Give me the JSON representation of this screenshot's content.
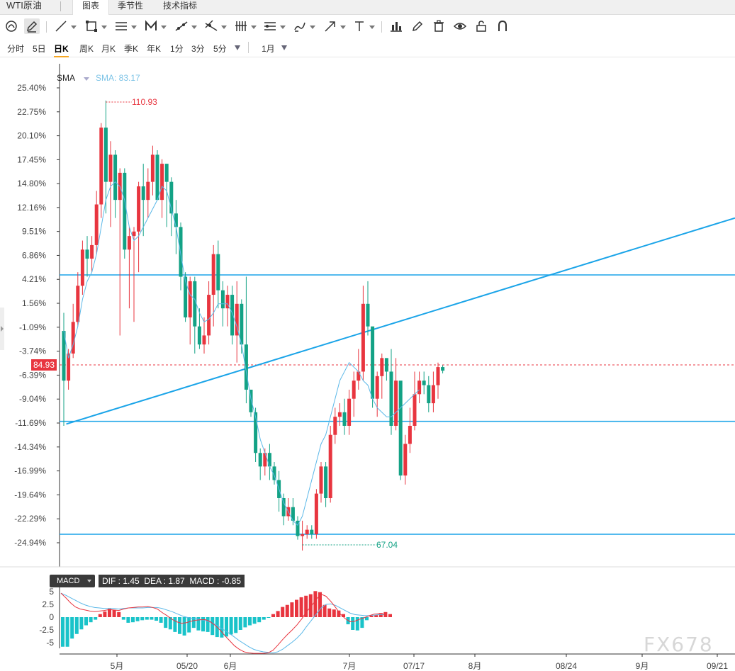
{
  "header": {
    "symbol": "WTI原油",
    "tabs": [
      {
        "label": "图表",
        "active": true
      },
      {
        "label": "季节性",
        "active": false
      },
      {
        "label": "技术指标",
        "active": false
      }
    ]
  },
  "toolbar": {
    "tools": [
      "magnet-icon",
      "pencil-icon",
      "line-icon",
      "rectangle-icon",
      "channel-icon",
      "pattern-icon",
      "ray-icon",
      "fib-icon",
      "pitchfork-icon",
      "gann-icon",
      "brush-icon",
      "arrow-icon",
      "text-icon",
      "bar-chart-icon",
      "edit-icon",
      "trash-icon",
      "eye-icon",
      "lock-icon",
      "magnet-u-icon"
    ]
  },
  "periods": {
    "items": [
      "分时",
      "5日",
      "日K",
      "周K",
      "月K",
      "季K",
      "年K",
      "1分",
      "3分",
      "5分"
    ],
    "active": "日K",
    "range": "1月"
  },
  "indicator": {
    "name": "SMA",
    "value_label": "SMA: 83.17"
  },
  "price_tag": "84.93",
  "high_marker": "110.93",
  "low_marker": "67.04",
  "macd": {
    "selector": "MACD",
    "readout": "DIF : 1.45  DEA : 1.87  MACD : -0.85",
    "yticks": [
      "5",
      "2.5",
      "0",
      "-2.5",
      "-5"
    ]
  },
  "watermark": "FX678",
  "colors": {
    "up": "#e8353f",
    "down": "#13a285",
    "sma": "#5bb8e8",
    "trendline": "#1aa4e8",
    "dif": "#e8353f",
    "dea": "#5bb8e8",
    "macd_pos": "#e8353f",
    "macd_neg": "#19c3c9"
  },
  "chart_data": {
    "type": "candlestick",
    "y_axis_ticks": [
      "25.40%",
      "22.75%",
      "20.10%",
      "17.45%",
      "14.80%",
      "12.16%",
      "9.51%",
      "6.86%",
      "4.21%",
      "1.56%",
      "-1.09%",
      "-3.74%",
      "-6.39%",
      "-9.04%",
      "-11.69%",
      "-14.34%",
      "-16.99%",
      "-19.64%",
      "-22.29%",
      "-24.94%"
    ],
    "x_axis_ticks": [
      "5月",
      "05/20",
      "6月",
      "7月",
      "07/17",
      "8月",
      "08/24",
      "9月",
      "09/21"
    ],
    "yrange_pct": [
      -24.94,
      25.4
    ],
    "candles": [
      [
        -1.5,
        -7,
        -12,
        0.5
      ],
      [
        -7,
        -4,
        -8,
        -3.5
      ],
      [
        -4,
        -0.5,
        -4.5,
        1.5
      ],
      [
        -0.5,
        3.5,
        -1,
        5
      ],
      [
        3.5,
        7.5,
        2.5,
        8.5
      ],
      [
        7.5,
        6.5,
        4.5,
        9
      ],
      [
        6.5,
        8,
        5,
        9
      ],
      [
        8,
        12.5,
        7,
        14
      ],
      [
        12.5,
        21,
        11,
        21.5
      ],
      [
        21,
        15,
        11.5,
        24
      ],
      [
        15,
        18,
        10,
        19.5
      ],
      [
        18,
        13,
        11,
        18.5
      ],
      [
        13,
        16,
        -2,
        16.5
      ],
      [
        16,
        7.5,
        6.5,
        16.5
      ],
      [
        7.5,
        9,
        1,
        10
      ],
      [
        9,
        9.5,
        -0.5,
        10
      ],
      [
        9.5,
        14.5,
        5,
        15
      ],
      [
        14.5,
        13,
        9,
        17
      ],
      [
        13,
        15,
        11,
        16.5
      ],
      [
        15,
        18,
        13.5,
        19
      ],
      [
        18,
        13,
        13,
        18.5
      ],
      [
        13,
        17,
        11,
        17.5
      ],
      [
        17,
        15,
        10,
        17
      ],
      [
        15,
        11.5,
        9,
        15.5
      ],
      [
        11.5,
        10,
        7,
        13
      ],
      [
        10,
        4.5,
        3,
        10.5
      ],
      [
        4.5,
        0,
        -0.5,
        5
      ],
      [
        0,
        4,
        -3,
        4.5
      ],
      [
        4,
        -1,
        -4,
        4.5
      ],
      [
        -1,
        -3,
        -3.5,
        1
      ],
      [
        -3,
        -2,
        -4,
        0
      ],
      [
        -2,
        2.5,
        -3,
        4
      ],
      [
        2.5,
        7,
        -1,
        8
      ],
      [
        7,
        3,
        1,
        8.5
      ],
      [
        3,
        1,
        -1,
        4
      ],
      [
        1,
        2.5,
        -1,
        3.5
      ],
      [
        2.5,
        -2,
        -3,
        3.5
      ],
      [
        -2,
        1.5,
        -5,
        4
      ],
      [
        1.5,
        -3,
        -4,
        2
      ],
      [
        -3,
        -8,
        -9.5,
        4.5
      ],
      [
        -8,
        -10.5,
        -11,
        -8
      ],
      [
        -10.5,
        -15,
        -16,
        -10
      ],
      [
        -15,
        -16.5,
        -18,
        -14.5
      ],
      [
        -16.5,
        -15,
        -17.5,
        -14.5
      ],
      [
        -15,
        -16.5,
        -18,
        -14
      ],
      [
        -16.5,
        -18,
        -18.5,
        -16
      ],
      [
        -18,
        -20,
        -21.5,
        -17
      ],
      [
        -20,
        -22,
        -23,
        -19.5
      ],
      [
        -22,
        -21,
        -22.5,
        -20
      ],
      [
        -21,
        -22.5,
        -23,
        -20
      ],
      [
        -22.5,
        -24.2,
        -24.6,
        -22
      ],
      [
        -24.2,
        -24,
        -25.8,
        -22.5
      ],
      [
        -24,
        -23.5,
        -24.5,
        -23
      ],
      [
        -23.5,
        -24,
        -24.5,
        -23
      ],
      [
        -24,
        -19.5,
        -24.5,
        -19
      ],
      [
        -19.5,
        -16.5,
        -20.5,
        -16
      ],
      [
        -16.5,
        -20,
        -21,
        -16
      ],
      [
        -20,
        -13,
        -20.5,
        -12
      ],
      [
        -13,
        -11,
        -14,
        -10
      ],
      [
        -11,
        -10.5,
        -12,
        -9.5
      ],
      [
        -10.5,
        -12,
        -13,
        -9
      ],
      [
        -12,
        -9,
        -13,
        -8
      ],
      [
        -9,
        -7,
        -11,
        -6
      ],
      [
        -7,
        -6,
        -8,
        -3.5
      ],
      [
        -6,
        1.5,
        -7,
        3.5
      ],
      [
        1.5,
        -1,
        -2,
        4
      ],
      [
        -1,
        -9,
        -10,
        -4
      ],
      [
        -9,
        -6.5,
        -11,
        -6
      ],
      [
        -6.5,
        -4.5,
        -9,
        -4
      ],
      [
        -4.5,
        -6,
        -7,
        -5.5
      ],
      [
        -6,
        -12,
        -13,
        -3.5
      ],
      [
        -12,
        -7,
        -12.5,
        -4.5
      ],
      [
        -7,
        -17.5,
        -18,
        -8
      ],
      [
        -17.5,
        -14,
        -18.5,
        -13
      ],
      [
        -14,
        -12,
        -15,
        -10
      ],
      [
        -12,
        -8.5,
        -12.5,
        -6
      ],
      [
        -8.5,
        -7,
        -9.5,
        -6
      ],
      [
        -7,
        -7.5,
        -8.5,
        -6
      ],
      [
        -7.5,
        -9.5,
        -10.5,
        -6.5
      ],
      [
        -9.5,
        -7.5,
        -10.5,
        -6
      ],
      [
        -7.5,
        -5.5,
        -9,
        -5
      ],
      [
        -5.5,
        -5.9,
        -6.2,
        -5.3
      ]
    ],
    "sma": [
      -1.5,
      -4.5,
      -3,
      -1,
      2,
      4,
      5,
      7,
      10,
      13,
      14.5,
      15,
      14.5,
      13,
      10,
      8.5,
      9,
      10,
      11,
      12,
      13,
      14.5,
      14,
      12,
      10,
      7,
      4,
      2.5,
      2,
      0.5,
      -0.5,
      -0.2,
      0.5,
      1.5,
      1.5,
      1.5,
      0.5,
      -1,
      -3,
      -6,
      -9,
      -11,
      -13.5,
      -15,
      -16.5,
      -17.5,
      -19,
      -20.5,
      -21.5,
      -22.5,
      -23,
      -22,
      -20,
      -18,
      -16,
      -14,
      -13,
      -11,
      -9,
      -7,
      -6,
      -5,
      -5.5,
      -6,
      -7,
      -7.5,
      -9,
      -10,
      -10.5,
      -11,
      -11,
      -10.5,
      -10,
      -9.5,
      -9,
      -8.5,
      -8
    ],
    "horizontal_lines_pct": [
      4.7,
      -11.5,
      -24.0
    ],
    "trendline_pct": [
      [
        -11.8,
        1
      ],
      [
        11,
        100
      ]
    ],
    "macd_series": {
      "dif": [
        4.7,
        3.8,
        2.8,
        2,
        1.6,
        1.4,
        1.2,
        1.1,
        1.2,
        1.3,
        1.5,
        1.4,
        1.3,
        1.6,
        1.8,
        1.9,
        2.0,
        2.0,
        2.1,
        1.9,
        1.6,
        0.9,
        0.3,
        -0.4,
        -0.9,
        -1.2,
        -1.1,
        -0.8,
        -0.6,
        -0.5,
        -0.5,
        -0.9,
        -1.6,
        -2.5,
        -3.6,
        -4.6,
        -5.6,
        -6.3,
        -6.8,
        -7,
        -7.1,
        -7.1,
        -7.1,
        -7,
        -6.5,
        -5.5,
        -4.4,
        -3.4,
        -2.5,
        -1.5,
        -0.3,
        1.1,
        2.2,
        3.5,
        4.5,
        4.1,
        3.1,
        1.9,
        0.6,
        -0.3,
        -0.9,
        -0.8,
        -0.4,
        -0.1,
        0.3,
        0.6,
        0.7,
        0.6
      ],
      "dea": [
        4.7,
        4.3,
        3.8,
        3.3,
        2.8,
        2.4,
        2.1,
        1.9,
        1.8,
        1.7,
        1.7,
        1.7,
        1.6,
        1.7,
        1.8,
        1.8,
        1.8,
        1.8,
        1.9,
        1.9,
        1.9,
        1.7,
        1.4,
        1.1,
        0.7,
        0.3,
        0.0,
        -0.2,
        -0.3,
        -0.5,
        -0.7,
        -1,
        -1.4,
        -2,
        -2.6,
        -3.2,
        -3.9,
        -4.6,
        -5.2,
        -5.8,
        -6.3,
        -6.6,
        -6.8,
        -6.9,
        -7,
        -6.8,
        -6.3,
        -5.6,
        -4.9,
        -4.1,
        -3.1,
        -1.8,
        -0.6,
        0.6,
        1.8,
        2.5,
        2.6,
        2.3,
        1.8,
        1.3,
        0.8,
        0.5,
        0.4,
        0.3,
        0.3,
        0.4,
        0.5,
        0.5
      ],
      "macd": [
        -5.8,
        -5.8,
        -4.2,
        -3.3,
        -2.4,
        -1.6,
        -1.0,
        -0.5,
        0.6,
        1.1,
        1.7,
        1.4,
        1.0,
        -0.5,
        -1.1,
        -1.0,
        -0.8,
        -0.6,
        -0.5,
        -0.5,
        -0.7,
        -1.1,
        -2.1,
        -2.4,
        -2.9,
        -3.3,
        -3.6,
        -3.0,
        -2.1,
        -2.6,
        -2.8,
        -2.9,
        -3.5,
        -3.9,
        -4.0,
        -3.8,
        -3.4,
        -3.1,
        -2.5,
        -2.0,
        -1.6,
        -1.3,
        -1.0,
        -0.5,
        -0.1,
        0.6,
        1.2,
        2.0,
        2.4,
        2.9,
        3.4,
        3.9,
        4.2,
        4.5,
        5.1,
        4.9,
        2.4,
        1.7,
        1.5,
        1.3,
        0.6,
        -1.4,
        -2.5,
        -2.6,
        -2.1,
        -0.6,
        0.3,
        0.4,
        0.8,
        1.0,
        0.6
      ]
    }
  }
}
